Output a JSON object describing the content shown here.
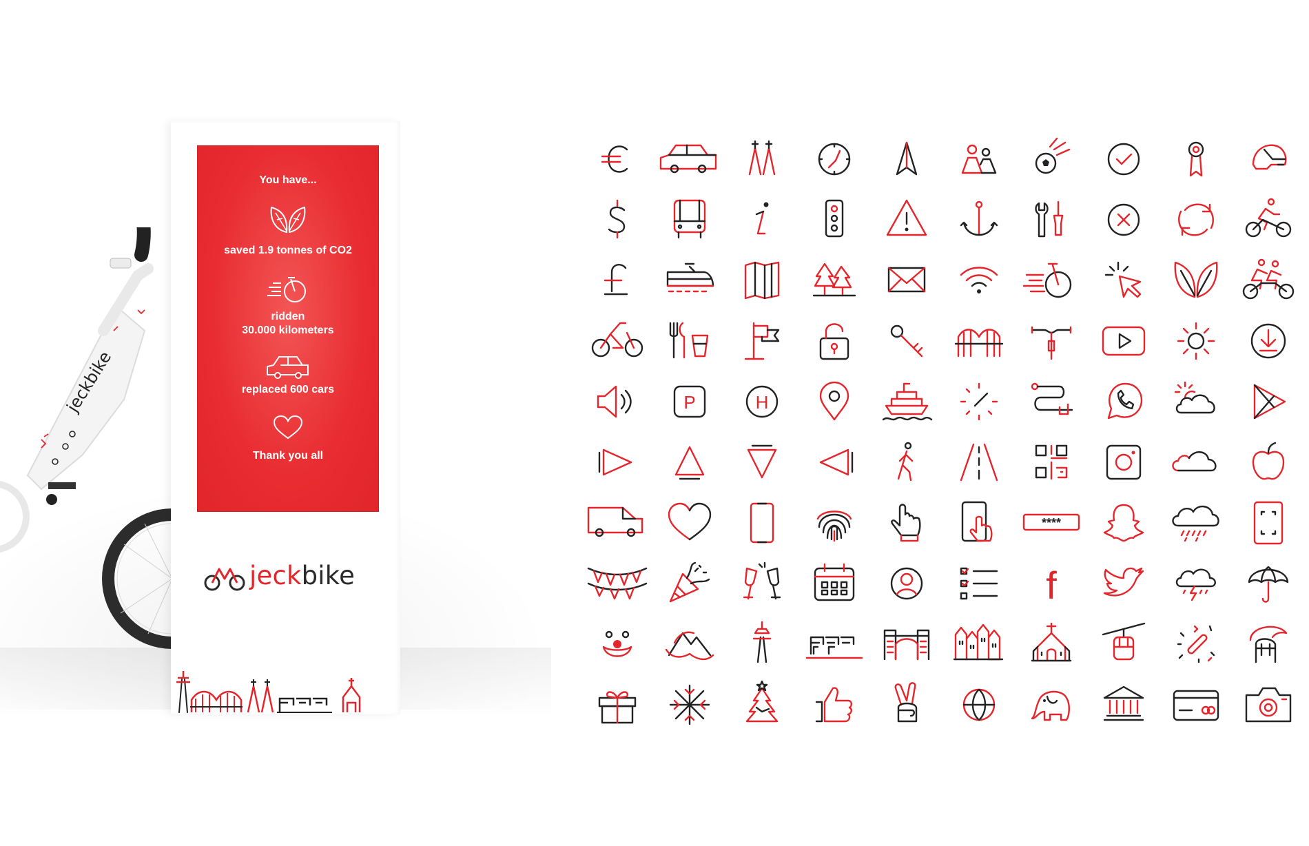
{
  "kiosk": {
    "heading": "You have...",
    "stats": [
      {
        "icon": "leaves-icon",
        "lines": [
          "saved 1.9 tonnes of CO2"
        ]
      },
      {
        "icon": "speeding-bike-icon",
        "lines": [
          "ridden",
          "30.000 kilometers"
        ]
      },
      {
        "icon": "car-icon",
        "lines": [
          "replaced 600 cars"
        ]
      },
      {
        "icon": "heart-icon",
        "lines": [
          "Thank you all"
        ]
      }
    ],
    "brand": {
      "red_part": "jeck",
      "dark_part": "bike"
    }
  },
  "bike_frame_text": "jeckbike",
  "colors": {
    "accent": "#e3262c",
    "ink": "#222222",
    "background": "#ffffff"
  },
  "icon_grid": [
    [
      "euro-icon",
      "car-icon",
      "cathedral-spires-icon",
      "compass-icon",
      "navigation-arrow-icon",
      "people-icon",
      "soccer-ball-icon",
      "check-circle-icon",
      "award-medal-icon",
      "bike-helmet-icon"
    ],
    [
      "dollar-icon",
      "bus-icon",
      "info-icon",
      "traffic-light-icon",
      "warning-icon",
      "anchor-icon",
      "tools-icon",
      "close-circle-icon",
      "refresh-icon",
      "cyclist-icon"
    ],
    [
      "pound-icon",
      "train-icon",
      "map-icon",
      "forest-icon",
      "mail-icon",
      "wifi-icon",
      "speeding-bike-icon",
      "cursor-click-icon",
      "leaves-icon",
      "tandem-cyclists-icon"
    ],
    [
      "bicycle-icon",
      "restaurant-icon",
      "flag-post-icon",
      "unlocked-padlock-icon",
      "key-icon",
      "bridge-icon",
      "handlebar-icon",
      "play-button-icon",
      "sun-icon",
      "download-icon"
    ],
    [
      "speaker-icon",
      "parking-icon",
      "helipad-icon",
      "location-pin-icon",
      "ship-icon",
      "clock-icon",
      "route-icon",
      "whatsapp-icon",
      "sun-cloud-icon",
      "google-play-icon"
    ],
    [
      "play-triangle-right-icon",
      "triangle-up-icon",
      "triangle-down-icon",
      "triangle-left-icon",
      "pedestrian-icon",
      "road-icon",
      "qr-code-icon",
      "instagram-icon",
      "cloud-icon",
      "apple-icon"
    ],
    [
      "van-icon",
      "heart-icon",
      "smartphone-icon",
      "fingerprint-icon",
      "hand-pointer-icon",
      "phone-tap-icon",
      "password-field-icon",
      "snapchat-icon",
      "rain-cloud-icon",
      "phone-scan-icon"
    ],
    [
      "bunting-icon",
      "party-popper-icon",
      "champagne-toast-icon",
      "calendar-icon",
      "user-circle-icon",
      "checklist-icon",
      "facebook-icon",
      "twitter-icon",
      "storm-cloud-icon",
      "umbrella-icon"
    ],
    [
      "clown-face-icon",
      "mountains-icon",
      "tv-tower-icon",
      "harbour-cranes-icon",
      "city-gate-icon",
      "old-town-houses-icon",
      "church-icon",
      "cable-car-icon",
      "confetti-icon",
      "helmet-crest-icon"
    ],
    [
      "gift-icon",
      "snowflake-icon",
      "christmas-tree-icon",
      "thumbs-up-icon",
      "peace-hand-icon",
      "globe-icon",
      "elephant-icon",
      "museum-icon",
      "credit-card-icon",
      "camera-icon"
    ]
  ],
  "password_mask": "****",
  "facebook_glyph": "f",
  "parking_glyph": "P",
  "helipad_glyph": "H",
  "info_glyph": "i"
}
